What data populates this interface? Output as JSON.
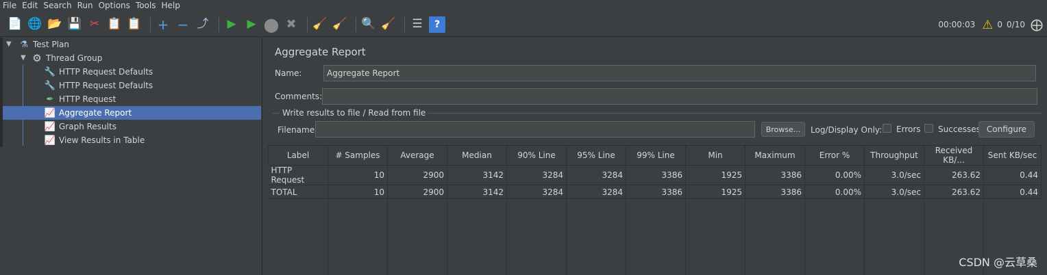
{
  "menu": [
    "File",
    "Edit",
    "Search",
    "Run",
    "Options",
    "Tools",
    "Help"
  ],
  "toolbar": {
    "timer": "00:00:03",
    "warnings": "0",
    "threads": "0/10"
  },
  "tree": {
    "test_plan": "Test Plan",
    "thread_group": "Thread Group",
    "items": [
      "HTTP Request Defaults",
      "HTTP Request Defaults",
      "HTTP Request",
      "Aggregate Report",
      "Graph Results",
      "View Results in Table"
    ]
  },
  "panel": {
    "title": "Aggregate Report",
    "name_label": "Name:",
    "name_value": "Aggregate Report",
    "comments_label": "Comments:",
    "comments_value": "",
    "fieldset_legend": "Write results to file / Read from file",
    "filename_label": "Filename",
    "filename_value": "",
    "browse_label": "Browse...",
    "log_display_label": "Log/Display Only:",
    "errors_label": "Errors",
    "successes_label": "Successes",
    "configure_label": "Configure"
  },
  "table": {
    "headers": [
      "Label",
      "# Samples",
      "Average",
      "Median",
      "90% Line",
      "95% Line",
      "99% Line",
      "Min",
      "Maximum",
      "Error %",
      "Throughput",
      "Received KB/...",
      "Sent KB/sec"
    ],
    "rows": [
      [
        "HTTP Request",
        "10",
        "2900",
        "3142",
        "3284",
        "3284",
        "3386",
        "1925",
        "3386",
        "0.00%",
        "3.0/sec",
        "263.62",
        "0.44"
      ],
      [
        "TOTAL",
        "10",
        "2900",
        "3142",
        "3284",
        "3284",
        "3386",
        "1925",
        "3386",
        "0.00%",
        "3.0/sec",
        "263.62",
        "0.44"
      ]
    ]
  },
  "watermark": "CSDN @云草桑"
}
